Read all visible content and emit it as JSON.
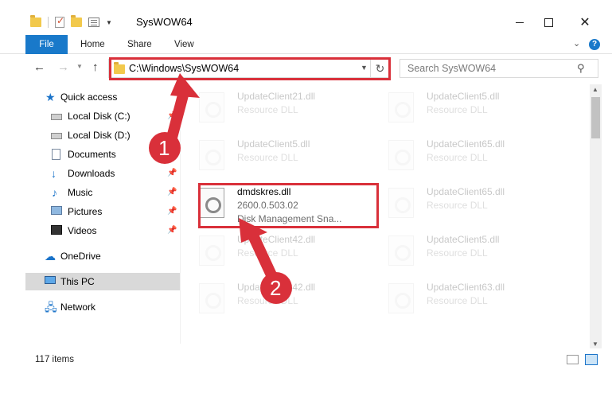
{
  "window": {
    "title": "SysWOW64",
    "minimize": "minimize",
    "maximize": "maximize",
    "close": "✕"
  },
  "ribbon": {
    "tabs": [
      "File",
      "Home",
      "Share",
      "View"
    ]
  },
  "address": {
    "path": "C:\\Windows\\SysWOW64",
    "search_placeholder": "Search SysWOW64"
  },
  "nav": {
    "items": [
      {
        "label": "Quick access",
        "icon": "star-icon"
      },
      {
        "label": "Local Disk (C:)",
        "icon": "drive-icon"
      },
      {
        "label": "Local Disk (D:)",
        "icon": "drive-icon"
      },
      {
        "label": "Documents",
        "icon": "documents-icon"
      },
      {
        "label": "Downloads",
        "icon": "download-icon"
      },
      {
        "label": "Music",
        "icon": "music-icon"
      },
      {
        "label": "Pictures",
        "icon": "pictures-icon"
      },
      {
        "label": "Videos",
        "icon": "videos-icon"
      },
      {
        "label": "OneDrive",
        "icon": "cloud-icon"
      },
      {
        "label": "This PC",
        "icon": "computer-icon"
      },
      {
        "label": "Network",
        "icon": "network-icon"
      }
    ]
  },
  "files": [
    {
      "name": "UpdateClient21.dll",
      "type": "Resource DLL"
    },
    {
      "name": "UpdateClient5.dll",
      "type": "Resource DLL"
    },
    {
      "name": "UpdateClient5.dll",
      "type": "Resource DLL"
    },
    {
      "name": "UpdateClient65.dll",
      "type": "Resource DLL"
    },
    {
      "name": "dmdskres.dll",
      "version": "2600.0.503.02",
      "description": "Disk Management Sna..."
    },
    {
      "name": "UpdateClient65.dll",
      "type": "Resource DLL"
    },
    {
      "name": "UpdateClient42.dll",
      "type": "Resource DLL"
    },
    {
      "name": "UpdateClient5.dll",
      "type": "Resource DLL"
    },
    {
      "name": "UpdateClient42.dll",
      "type": "Resource DLL"
    },
    {
      "name": "UpdateClient63.dll",
      "type": "Resource DLL"
    }
  ],
  "status": {
    "item_count": "117 items"
  },
  "annotations": {
    "step1": "1",
    "step2": "2",
    "color": "#d9303a"
  }
}
